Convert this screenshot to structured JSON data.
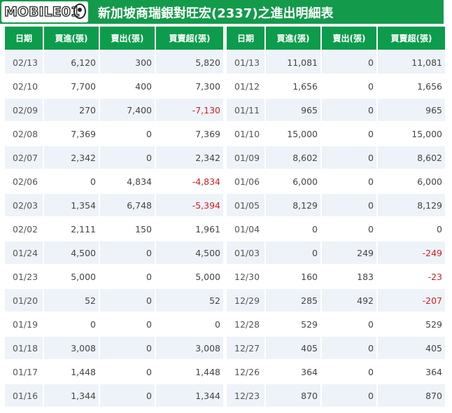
{
  "logo": "MOBILE01",
  "title": "新加坡商瑞銀對旺宏(2337)之進出明細表",
  "columns": [
    "日期",
    "買進(張)",
    "賣出(張)",
    "買賣超(張)"
  ],
  "left_rows": [
    [
      "02/13",
      "6,120",
      "300",
      "5,820"
    ],
    [
      "02/10",
      "7,700",
      "400",
      "7,300"
    ],
    [
      "02/09",
      "270",
      "7,400",
      "-7,130"
    ],
    [
      "02/08",
      "7,369",
      "0",
      "7,369"
    ],
    [
      "02/07",
      "2,342",
      "0",
      "2,342"
    ],
    [
      "02/06",
      "0",
      "4,834",
      "-4,834"
    ],
    [
      "02/03",
      "1,354",
      "6,748",
      "-5,394"
    ],
    [
      "02/02",
      "2,111",
      "150",
      "1,961"
    ],
    [
      "01/24",
      "4,500",
      "0",
      "4,500"
    ],
    [
      "01/23",
      "5,000",
      "0",
      "5,000"
    ],
    [
      "01/20",
      "52",
      "0",
      "52"
    ],
    [
      "01/19",
      "0",
      "0",
      "0"
    ],
    [
      "01/18",
      "3,008",
      "0",
      "3,008"
    ],
    [
      "01/17",
      "1,448",
      "0",
      "1,448"
    ],
    [
      "01/16",
      "1,344",
      "0",
      "1,344"
    ]
  ],
  "right_rows": [
    [
      "01/13",
      "11,081",
      "0",
      "11,081"
    ],
    [
      "01/12",
      "1,656",
      "0",
      "1,656"
    ],
    [
      "01/11",
      "965",
      "0",
      "965"
    ],
    [
      "01/10",
      "15,000",
      "0",
      "15,000"
    ],
    [
      "01/09",
      "8,602",
      "0",
      "8,602"
    ],
    [
      "01/06",
      "6,000",
      "0",
      "6,000"
    ],
    [
      "01/05",
      "8,129",
      "0",
      "8,129"
    ],
    [
      "01/04",
      "0",
      "0",
      "0"
    ],
    [
      "01/03",
      "0",
      "249",
      "-249"
    ],
    [
      "12/30",
      "160",
      "183",
      "-23"
    ],
    [
      "12/29",
      "285",
      "492",
      "-207"
    ],
    [
      "12/28",
      "529",
      "0",
      "529"
    ],
    [
      "12/27",
      "405",
      "0",
      "405"
    ],
    [
      "12/26",
      "364",
      "0",
      "364"
    ],
    [
      "12/23",
      "870",
      "0",
      "870"
    ]
  ],
  "colors": {
    "header_green": "#0d9c4c",
    "title_green": "#149a4b",
    "row_tint": "#eef3f9",
    "negative": "#cc2222"
  }
}
